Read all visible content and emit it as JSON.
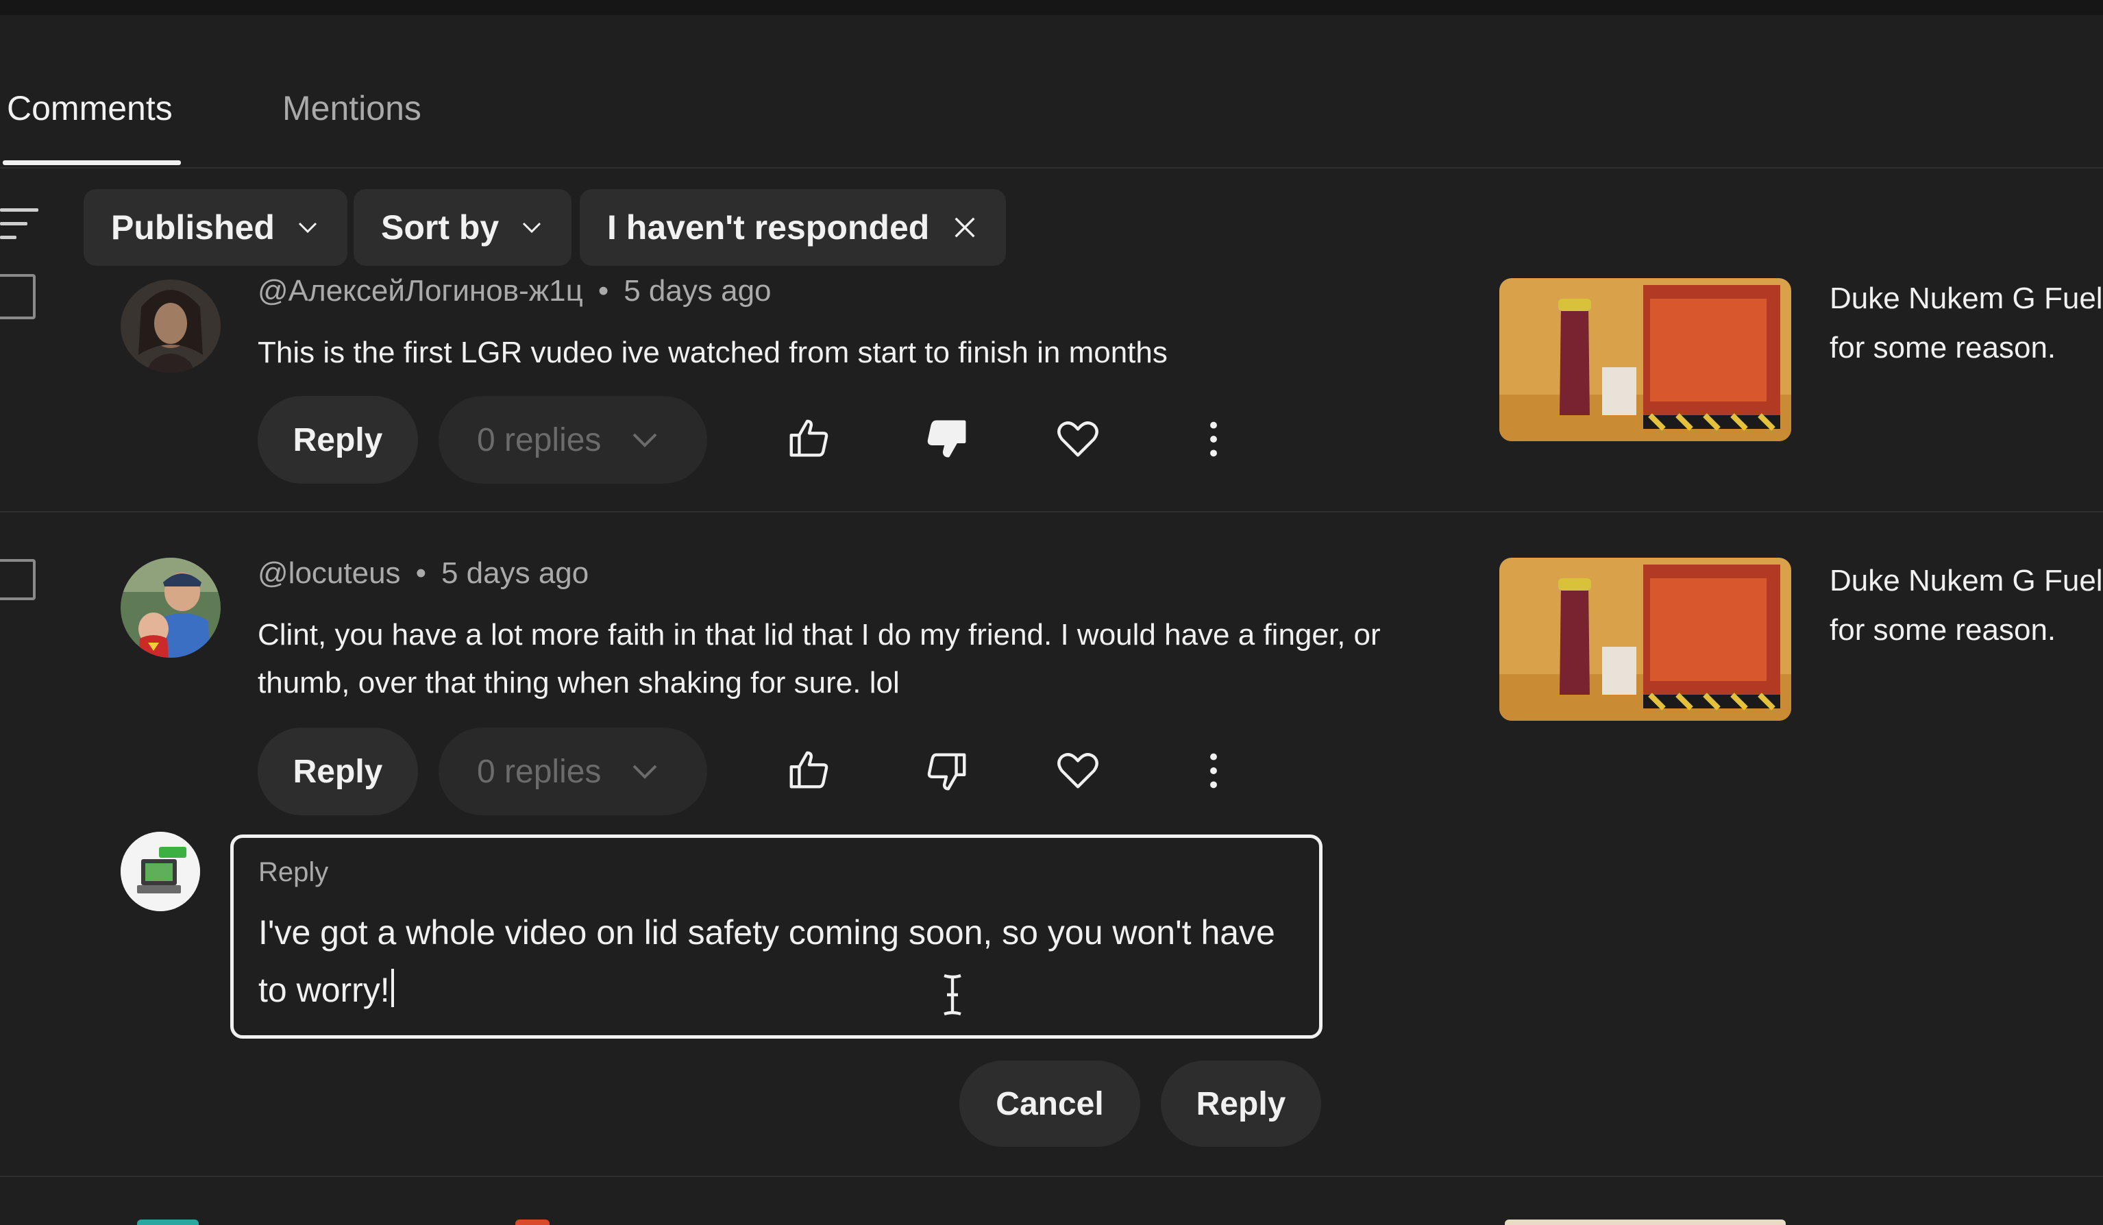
{
  "tabs": [
    {
      "label": "Comments",
      "active": true
    },
    {
      "label": "Mentions",
      "active": false
    }
  ],
  "filters": {
    "published": "Published",
    "sort_by": "Sort by",
    "responded": "I haven't responded"
  },
  "comments": [
    {
      "author": "@АлексейЛогинов-ж1ц",
      "time": "5 days ago",
      "text": "This is the first LGR vudeo ive watched from start to finish in months",
      "reply_label": "Reply",
      "replies_label": "0 replies",
      "disliked": true,
      "video_title_line1": "Duke Nukem G Fuel",
      "video_title_line2": "for some reason."
    },
    {
      "author": "@locuteus",
      "time": "5 days ago",
      "text": "Clint, you have a lot more faith in that lid that I do my friend. I would have a finger, or thumb, over that thing when shaking for sure. lol",
      "reply_label": "Reply",
      "replies_label": "0 replies",
      "disliked": false,
      "video_title_line1": "Duke Nukem G Fuel",
      "video_title_line2": "for some reason."
    }
  ],
  "reply_box": {
    "label": "Reply",
    "value": "I've got a whole video on lid safety coming soon, so you won't have to worry!"
  },
  "reply_actions": {
    "cancel": "Cancel",
    "reply": "Reply"
  },
  "icons": {
    "filter": "filter-icon",
    "chevron": "chevron-down-icon",
    "close": "close-icon",
    "like": "thumbs-up-icon",
    "dislike": "thumbs-down-icon",
    "heart": "heart-icon",
    "more": "more-vert-icon",
    "text_cursor": "text-cursor-icon"
  },
  "colors": {
    "background": "#1f1f1f",
    "chip": "#2d2d2d",
    "text_primary": "#f1f1f1",
    "text_secondary": "#aaaaaa"
  }
}
